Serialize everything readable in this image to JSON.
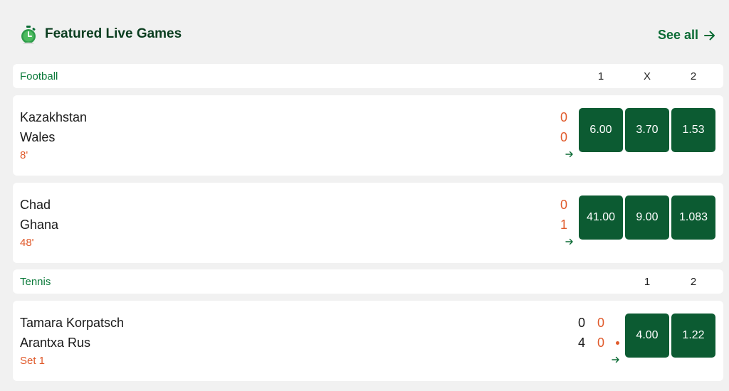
{
  "header": {
    "title": "Featured Live Games",
    "see_all": "See all"
  },
  "sections": [
    {
      "label": "Football",
      "columns": [
        "1",
        "X",
        "2"
      ],
      "matches": [
        {
          "home": "Kazakhstan",
          "away": "Wales",
          "time": "8'",
          "score_home": "0",
          "score_away": "0",
          "odds": [
            "6.00",
            "3.70",
            "1.53"
          ]
        },
        {
          "home": "Chad",
          "away": "Ghana",
          "time": "48'",
          "score_home": "0",
          "score_away": "1",
          "odds": [
            "41.00",
            "9.00",
            "1.083"
          ]
        }
      ]
    },
    {
      "label": "Tennis",
      "columns": [
        "1",
        "2"
      ],
      "matches": [
        {
          "home": "Tamara Korpatsch",
          "away": "Arantxa Rus",
          "time": "Set 1",
          "sets_home": "0",
          "sets_away": "4",
          "games_home": "0",
          "games_away": "0",
          "odds": [
            "4.00",
            "1.22"
          ]
        }
      ]
    }
  ],
  "colors": {
    "accent": "#0b6b35",
    "odds_bg": "#0c5b32",
    "live": "#e05a2b"
  },
  "icons": {
    "header": "stopwatch-icon",
    "see_all": "arrow-right-icon",
    "match_more": "arrow-right-icon",
    "serve": "serve-dot-icon"
  }
}
